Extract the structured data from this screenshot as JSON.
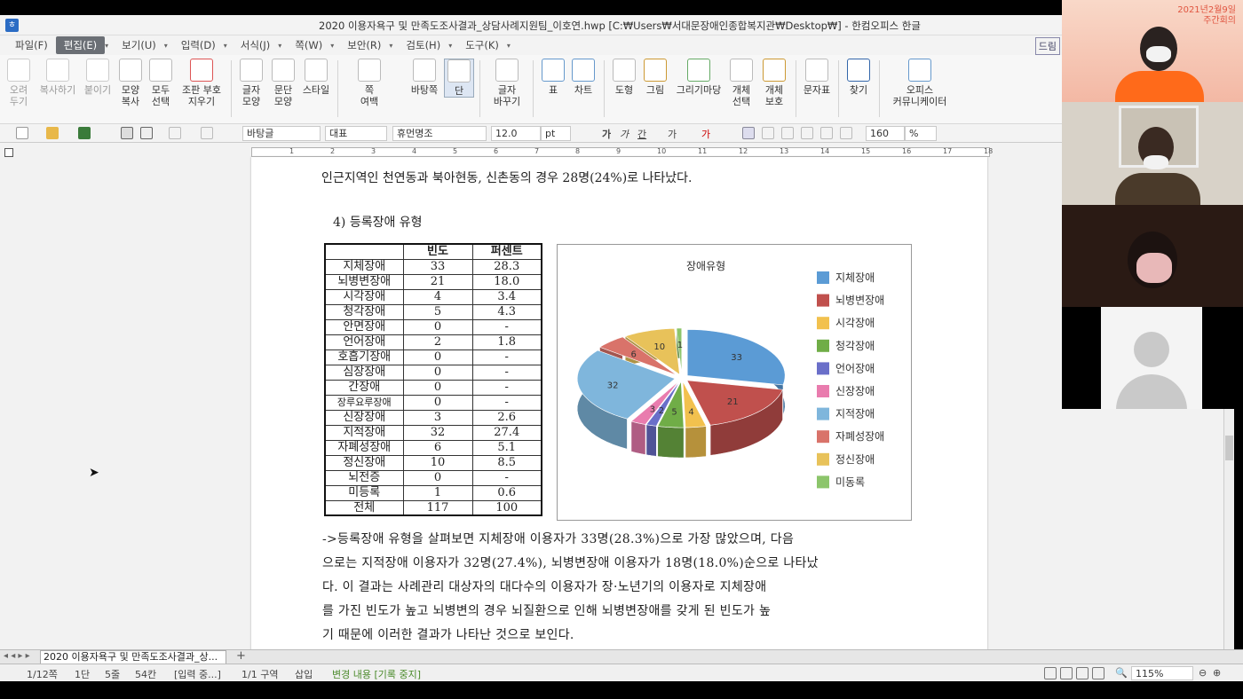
{
  "window": {
    "title": "2020 이용자욕구 및 만족도조사결과_상담사례지원팀_이호연.hwp [C:₩Users₩서대문장애인종합복지관₩Desktop₩] - 한컴오피스 한글"
  },
  "menu": {
    "items": [
      "파일(F)",
      "편집(E)",
      "보기(U)",
      "입력(D)",
      "서식(J)",
      "쪽(W)",
      "보안(R)",
      "검토(H)",
      "도구(K)"
    ],
    "right_label": "드림"
  },
  "ribbon": {
    "buttons": [
      "오려\n두기",
      "복사하기",
      "붙이기",
      "모양\n복사",
      "모두\n선택",
      "조판 부호\n지우기",
      "글자\n모양",
      "문단\n모양",
      "스타일",
      "쪽\n여백",
      "바탕쪽",
      "단",
      "글자\n바꾸기",
      "표",
      "차트",
      "도형",
      "그림",
      "그리기마당",
      "개체\n선택",
      "개체\n보호",
      "문자표",
      "찾기",
      "오피스\n커뮤니케이터"
    ]
  },
  "format_toolbar": {
    "style": "바탕글",
    "lang": "대표",
    "font": "휴먼명조",
    "size": "12.0",
    "unit": "pt",
    "zoom": "160",
    "zoom_unit": "%",
    "text_buttons": [
      "가",
      "가",
      "간",
      "가",
      "가"
    ]
  },
  "document": {
    "intro_line": "인근지역인 천연동과 북아현동, 신촌동의 경우 28명(24%)로 나타났다.",
    "heading": "4) 등록장애 유형",
    "table": {
      "headers": [
        "",
        "빈도",
        "퍼센트"
      ],
      "rows": [
        [
          "지체장애",
          "33",
          "28.3"
        ],
        [
          "뇌병변장애",
          "21",
          "18.0"
        ],
        [
          "시각장애",
          "4",
          "3.4"
        ],
        [
          "청각장애",
          "5",
          "4.3"
        ],
        [
          "안면장애",
          "0",
          "-"
        ],
        [
          "언어장애",
          "2",
          "1.8"
        ],
        [
          "호흡기장애",
          "0",
          "-"
        ],
        [
          "심장장애",
          "0",
          "-"
        ],
        [
          "간장애",
          "0",
          "-"
        ],
        [
          "장루요루장애",
          "0",
          "-"
        ],
        [
          "신장장애",
          "3",
          "2.6"
        ],
        [
          "지적장애",
          "32",
          "27.4"
        ],
        [
          "자폐성장애",
          "6",
          "5.1"
        ],
        [
          "정신장애",
          "10",
          "8.5"
        ],
        [
          "뇌전증",
          "0",
          "-"
        ],
        [
          "미등록",
          "1",
          "0.6"
        ],
        [
          "전체",
          "117",
          "100"
        ]
      ]
    },
    "paragraph_lines": [
      "->등록장애 유형을 살펴보면 지체장애 이용자가 33명(28.3%)으로 가장 많았으며, 다음",
      "으로는 지적장애 이용자가 32명(27.4%), 뇌병변장애 이용자가 18명(18.0%)순으로 나타났",
      "다. 이 결과는 사례관리 대상자의 대다수의 이용자가 장·노년기의 이용자로 지체장애",
      "를 가진 빈도가 높고 뇌병변의 경우 뇌질환으로 인해 뇌병변장애를 갖게 된 빈도가 높",
      "기 때문에 이러한 결과가 나타난 것으로 보인다."
    ]
  },
  "chart_data": {
    "type": "pie",
    "title": "장애유형",
    "categories": [
      "지체장애",
      "뇌병변장애",
      "시각장애",
      "청각장애",
      "언어장애",
      "신장장애",
      "지적장애",
      "자폐성장애",
      "정신장애",
      "미동록"
    ],
    "values": [
      33,
      21,
      4,
      5,
      2,
      3,
      32,
      6,
      10,
      1
    ],
    "colors": [
      "#5b9bd5",
      "#c0504d",
      "#f2c14e",
      "#70ad47",
      "#6a6fc9",
      "#e97cae",
      "#7fb6dc",
      "#d9736a",
      "#e8c25a",
      "#8cc56b"
    ],
    "legend_position": "right"
  },
  "tabs": {
    "doc_tab": "2020 이용자욕구 및 만족도조사결과_상..."
  },
  "status": {
    "page": "1/12쪽",
    "column": "1단",
    "line": "5줄",
    "col_pos": "54칸",
    "input_mode": "[입력 중...]",
    "section": "1/1 구역",
    "insert": "삽입",
    "track": "변경 내용 [기록 중지]",
    "zoom": "115%"
  },
  "video": {
    "banner_line1": "2021년2월9일",
    "banner_line2": "주간회의"
  }
}
